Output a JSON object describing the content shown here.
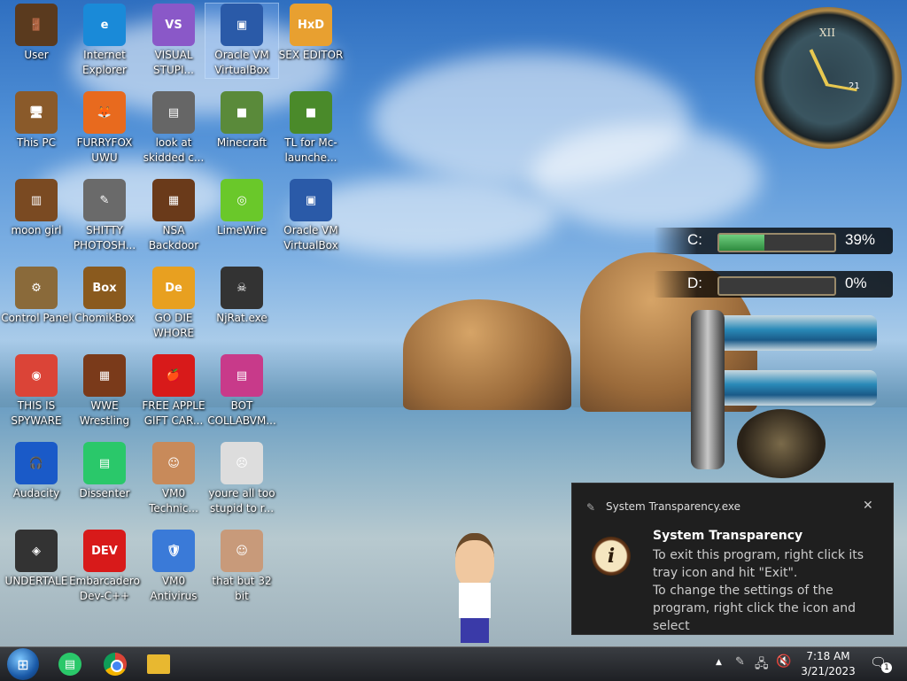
{
  "desktop": {
    "icons": [
      {
        "label": "User",
        "color": "#5a3a1e",
        "glyph": "🚪"
      },
      {
        "label": "Internet Explorer",
        "color": "#1a8ad8",
        "glyph": "e"
      },
      {
        "label": "VISUAL STUPI...",
        "color": "#8a58c8",
        "glyph": "VS"
      },
      {
        "label": "Oracle VM VirtualBox",
        "color": "#2a5aa8",
        "glyph": "▣"
      },
      {
        "label": "SEX EDITOR",
        "color": "#e8a030",
        "glyph": "HxD"
      },
      {
        "label": "This PC",
        "color": "#8a5a2a",
        "glyph": "🖥"
      },
      {
        "label": "FURRYFOX UWU",
        "color": "#e86a1e",
        "glyph": "🦊"
      },
      {
        "label": "look at skidded c...",
        "color": "#666666",
        "glyph": "▤"
      },
      {
        "label": "Minecraft",
        "color": "#5a8a3a",
        "glyph": "■"
      },
      {
        "label": "TL for Mc-launche...",
        "color": "#4a8a2a",
        "glyph": "■"
      },
      {
        "label": "moon girl",
        "color": "#7a4a22",
        "glyph": "▥"
      },
      {
        "label": "SHITTY PHOTOSH...",
        "color": "#6a6a6a",
        "glyph": "✎"
      },
      {
        "label": "NSA Backdoor",
        "color": "#6a3a1a",
        "glyph": "▦"
      },
      {
        "label": "LimeWire",
        "color": "#6ac82a",
        "glyph": "◎"
      },
      {
        "label": "Oracle VM VirtualBox",
        "color": "#2a5aa8",
        "glyph": "▣"
      },
      {
        "label": "Control Panel",
        "color": "#8a6a3a",
        "glyph": "⚙"
      },
      {
        "label": "ChomikBox",
        "color": "#8a5a1e",
        "glyph": "Box"
      },
      {
        "label": "GO DIE WHORE",
        "color": "#e8a020",
        "glyph": "De"
      },
      {
        "label": "NjRat.exe",
        "color": "#333333",
        "glyph": "☠"
      },
      {
        "label": "THIS IS SPYWARE",
        "color": "#db4437",
        "glyph": "◉"
      },
      {
        "label": "WWE Wrestling",
        "color": "#7a3a1a",
        "glyph": "▦"
      },
      {
        "label": "FREE APPLE GIFT CAR...",
        "color": "#d81a1a",
        "glyph": "🍎"
      },
      {
        "label": "BOT COLLABVM...",
        "color": "#c83a8a",
        "glyph": "▤"
      },
      {
        "label": "Audacity",
        "color": "#1a5ac8",
        "glyph": "🎧"
      },
      {
        "label": "Dissenter",
        "color": "#2ac86a",
        "glyph": "▤"
      },
      {
        "label": "VM0 Technic...",
        "color": "#c88a5a",
        "glyph": "☺"
      },
      {
        "label": "youre all too stupid to r...",
        "color": "#dddddd",
        "glyph": "☹"
      },
      {
        "label": "UNDERTALE",
        "color": "#333333",
        "glyph": "◈"
      },
      {
        "label": "Embarcadero Dev-C++",
        "color": "#d81a1a",
        "glyph": "DEV"
      },
      {
        "label": "VM0 Antivirus",
        "color": "#3a7ad8",
        "glyph": "🛡"
      },
      {
        "label": "that but 32 bit",
        "color": "#c89a7a",
        "glyph": "☺"
      }
    ]
  },
  "drives": [
    {
      "letter": "C:",
      "percent_text": "39%",
      "fill": 0.39
    },
    {
      "letter": "D:",
      "percent_text": "0%",
      "fill": 0.0
    }
  ],
  "clock": {
    "numeral_top": "XII",
    "inner": "21"
  },
  "notification": {
    "app": "System Transparency.exe",
    "title": "System Transparency",
    "line1": "To exit this program, right click its tray icon and hit \"Exit\".",
    "line2": "To change the settings of the program, right click the icon and select",
    "close": "✕"
  },
  "taskbar": {
    "time": "7:18 AM",
    "date": "3/21/2023",
    "tray_up": "▲",
    "notif_count": "1"
  },
  "colors": {
    "taskbar": "#1e2024",
    "notify_bg": "#1f1f1f",
    "drive_fill": "#2e8a3e"
  }
}
